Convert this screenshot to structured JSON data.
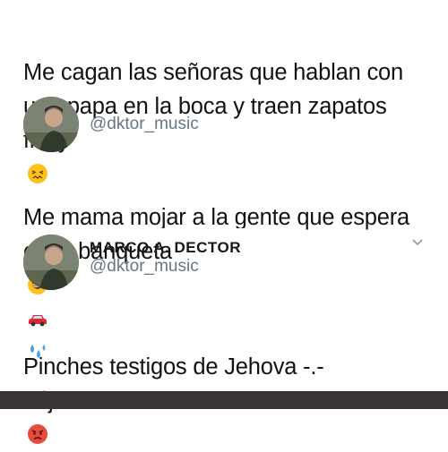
{
  "tweets": [
    {
      "text": "Me cagan las señoras que hablan con\nuna papa en la boca y traen zapatos\nflexy",
      "emoji": [
        "confounded-face"
      ]
    },
    {
      "text": "Me mama mojar a la gente que espera\nen la banqueta",
      "emoji": [
        "grinning-squinting-face",
        "red-car",
        "splashing-sweat"
      ]
    },
    {
      "text": "Pinches testigos de Jehova -.-\ndéjenme dormir !!!",
      "emoji": [
        "pouting-face"
      ]
    }
  ],
  "profiles": [
    {
      "display_name": "",
      "handle": "@dktor_music"
    },
    {
      "display_name": "Marco A. Dector",
      "handle": "@dktor_music"
    }
  ],
  "colors": {
    "text": "#111111",
    "handle": "#657786",
    "bottom_bar": "#3a3535"
  }
}
